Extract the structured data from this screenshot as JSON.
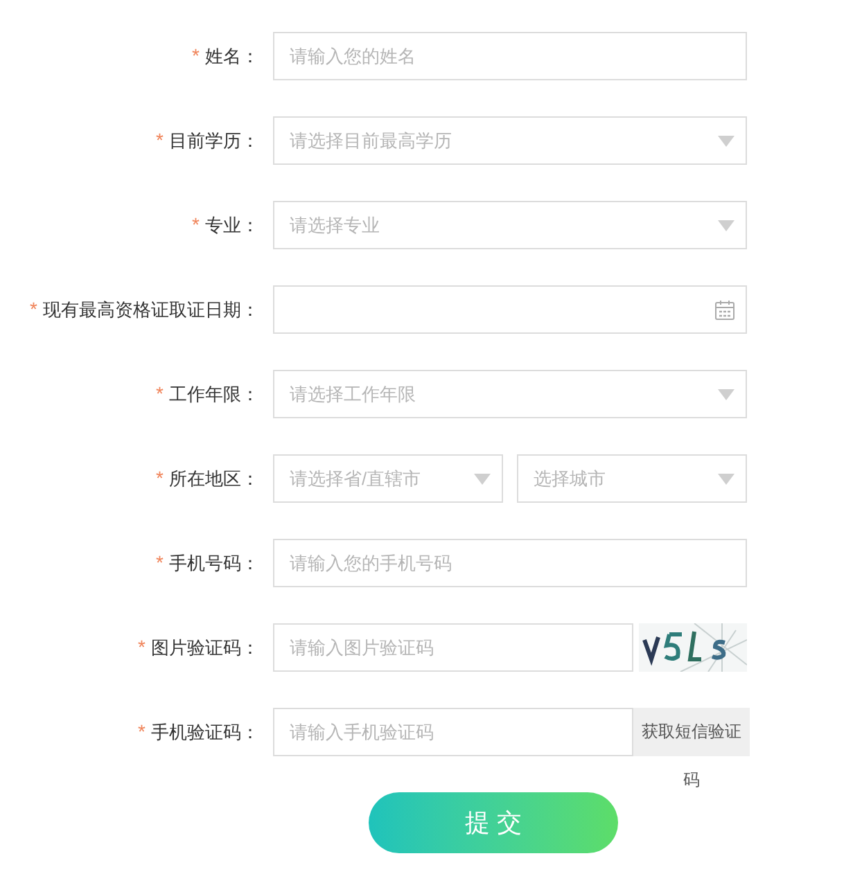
{
  "fields": [
    {
      "kind": "text",
      "mark": "*",
      "label": "姓名：",
      "placeholder": "请输入您的姓名"
    },
    {
      "kind": "select",
      "mark": "*",
      "label": "目前学历：",
      "placeholder": "请选择目前最高学历"
    },
    {
      "kind": "select",
      "mark": "*",
      "label": "专业：",
      "placeholder": "请选择专业"
    },
    {
      "kind": "date",
      "mark": "*",
      "label": "现有最高资格证取证日期："
    },
    {
      "kind": "select",
      "mark": "*",
      "label": "工作年限：",
      "placeholder": "请选择工作年限"
    },
    {
      "kind": "select_pair",
      "mark": "*",
      "label": "所在地区：",
      "placeholders": [
        "请选择省/直辖市",
        "选择城市"
      ]
    },
    {
      "kind": "text",
      "mark": "*",
      "label": "手机号码：",
      "placeholder": "请输入您的手机号码"
    },
    {
      "kind": "captcha",
      "mark": "*",
      "label": "图片验证码：",
      "placeholder": "请输入图片验证码"
    },
    {
      "kind": "sms",
      "mark": "*",
      "label": "手机验证码：",
      "placeholder": "请输入手机验证码",
      "button": "获取短信验证码"
    }
  ],
  "submit": "提 交"
}
